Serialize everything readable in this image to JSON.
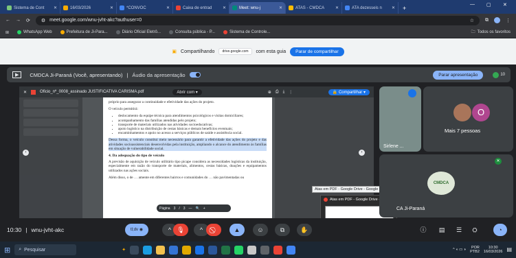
{
  "browser": {
    "tabs": [
      {
        "label": "Sistema de Cont",
        "color": "#7bc67b"
      },
      {
        "label": "16/03/2026",
        "color": "#f9ab00"
      },
      {
        "label": "*CONVOC",
        "color": "#4285f4"
      },
      {
        "label": "Caixa de entrad",
        "color": "#ea4335"
      },
      {
        "label": "Meet: wnu-j",
        "color": "#00897b"
      },
      {
        "label": "ATAS - CMDCA",
        "color": "#fbbc04"
      },
      {
        "label": "ATA dezesseis n",
        "color": "#4285f4"
      }
    ],
    "url": "meet.google.com/wnu-jvht-akc?authuser=0",
    "bookmarks": [
      "WhatsApp Web",
      "Prefeitura de Ji-Para...",
      "Diário Oficial Eletrô...",
      "Consulta pública - P...",
      "Sistema de Controle..."
    ],
    "all_bookmarks": "Todos os favoritos"
  },
  "sharebar": {
    "sharing_label": "Compartilhando",
    "domain": "drive.google.com",
    "with_tab": "com esta guia",
    "stop_label": "Parar de compartilhar"
  },
  "presentation": {
    "title": "CMDCA Ji-Paraná (Você, apresentando)",
    "audio_label": "Áudio da apresentação",
    "stop_label": "Parar apresentação",
    "participant_count": "10"
  },
  "pdf": {
    "filename": "Oficio_nº_0008_assinado JUSTIFICATIVA CARISMA.pdf",
    "open_with": "Abrir com",
    "share_label": "Compartilhar",
    "page_label": "Página",
    "page_current": "3",
    "page_sep": "/",
    "page_total": "3",
    "top_text": "próprio para assegurar a continuidade e efetividade das ações do projeto.",
    "intro": "O veículo permitirá:",
    "bullets": [
      "deslocamento da equipe técnica para atendimentos psicológicos e visitas domiciliares;",
      "acompanhamento das famílias atendidas pelo projeto;",
      "transporte de materiais utilizados nas atividades socioeducativas;",
      "apoio logístico na distribuição de cestas básicas e demais benefícios eventuais;",
      "encaminhamentos e apoio no acesso a serviços públicos de saúde e assistência social."
    ],
    "highlight": "Dessa forma, o veículo constitui meio necessário para garantir a efetividade das ações do projeto e das atividades socioassistenciais desenvolvidas pela instituição, ampliando o alcance do atendimento às famílias em situação de vulnerabilidade social.",
    "section": "4. Da adequação do tipo de veículo",
    "para1": "A previsão de aquisição de veículo utilitário tipo picape considera as necessidades logísticas da instituição, especialmente em razão do transporte de materiais, alimentos, cestas básicas, doações e equipamentos utilizados nas ações sociais.",
    "para2_start": "Além disso, o de",
    "para2_end": "amente em diferentes bairros e comunidades do",
    "para2_tail": "não pavimentadas ou"
  },
  "tooltip": "Atas em PDF - Google Drive - Google Chrome",
  "thumbnail_title": "Atas em PDF - Google Drive - G...",
  "participants": {
    "sirlene": "Sirlene ...",
    "more_initial": "O",
    "more": "Mais 7 pessoas",
    "cmdca": "CA Ji-Paraná",
    "logo_text": "CMDCA"
  },
  "controls": {
    "time": "10:30",
    "separator": "|",
    "code": "wnu-jvht-akc",
    "active_badge": "tl;dv"
  },
  "taskbar": {
    "search_placeholder": "Pesquisar",
    "lang": "POR",
    "lang2": "PTB2",
    "time": "10:30",
    "date": "16/03/2026"
  }
}
